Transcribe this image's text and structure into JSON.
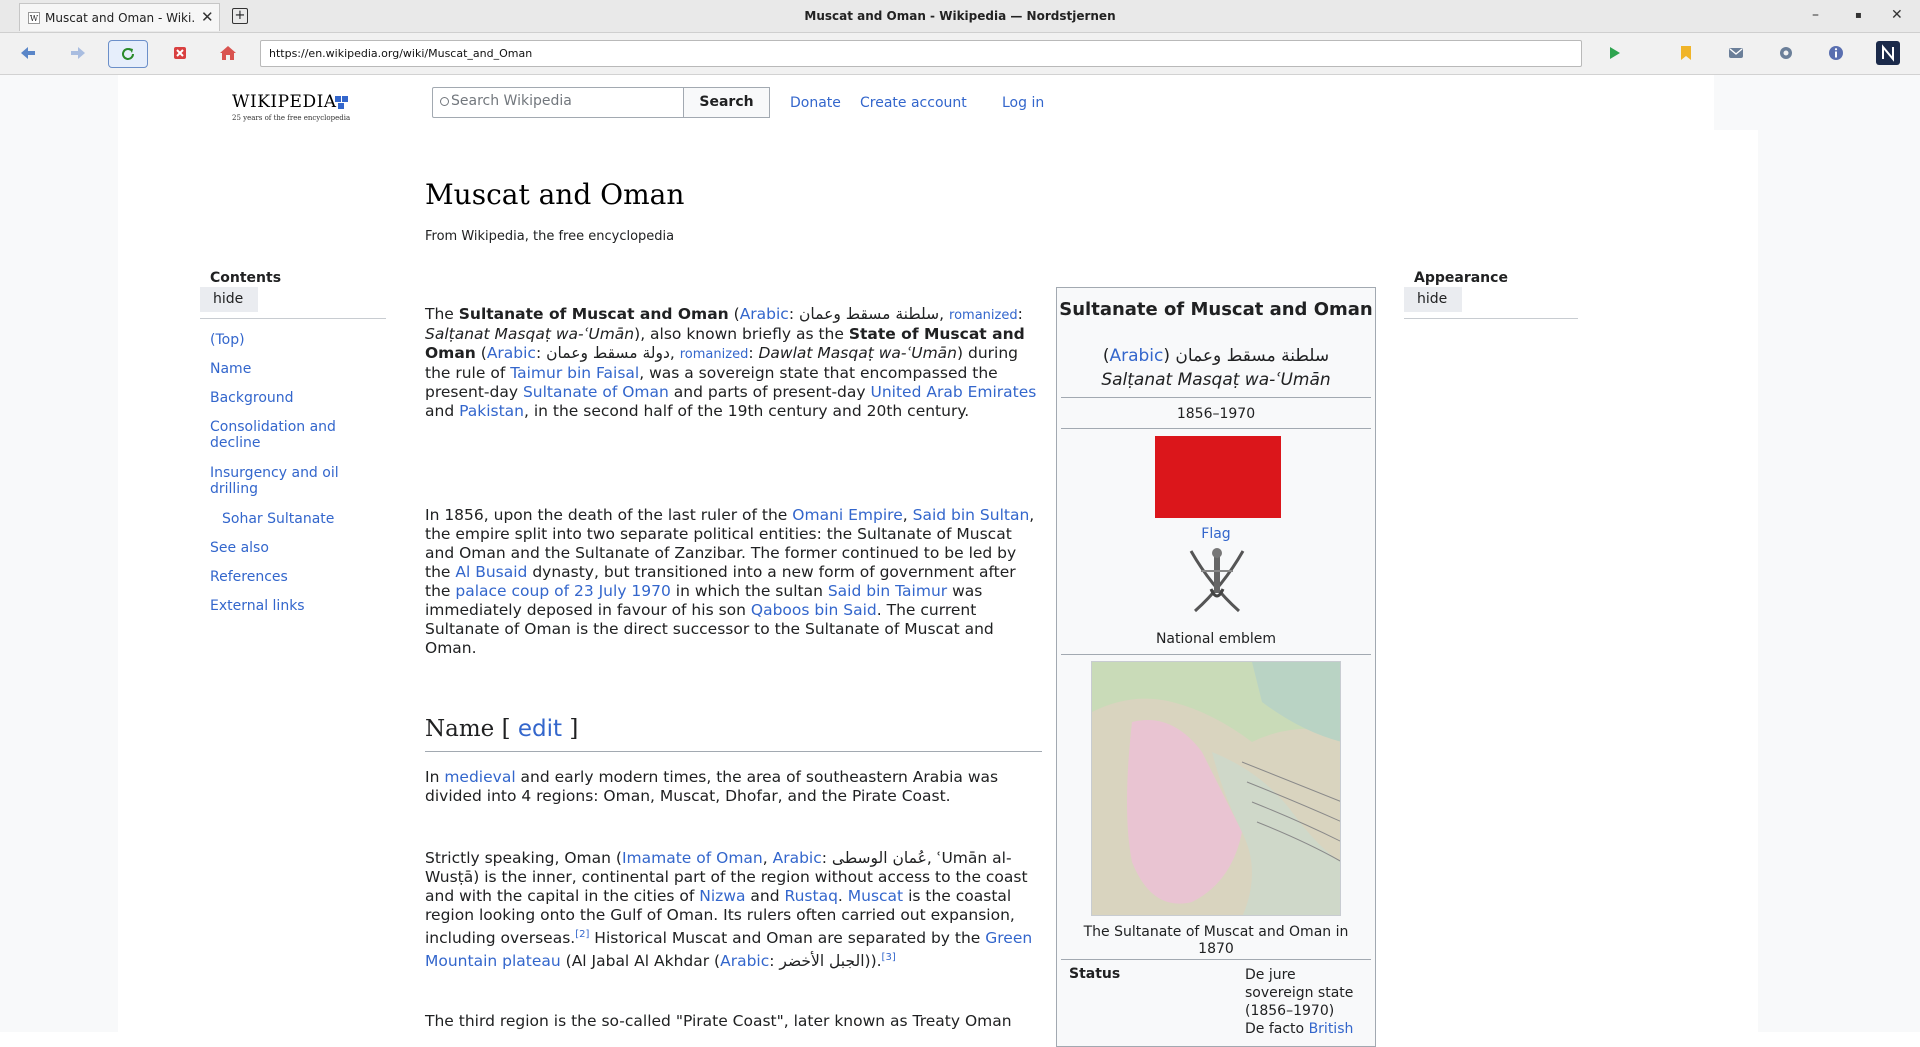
{
  "browser": {
    "tab_title": "Muscat and Oman - Wiki...",
    "tab_favicon": "W",
    "window_title": "Muscat and Oman - Wikipedia — Nordstjernen",
    "url": "https://en.wikipedia.org/wiki/Muscat_and_Oman",
    "icons": [
      "back-icon",
      "forward-icon",
      "reload-icon",
      "stop-icon",
      "home-icon",
      "play-icon",
      "bookmark-icon",
      "mail-icon",
      "gear-icon",
      "info-icon",
      "nordstjernen-icon"
    ],
    "win_min": "–",
    "win_max": "▪",
    "win_close": "✕",
    "tab_close": "✕",
    "newtab": "+"
  },
  "header": {
    "logo_word": "WIKIPEDIA",
    "logo_tag": "25 years of the free encyclopedia",
    "search_placeholder": "Search Wikipedia",
    "search_button": "Search",
    "donate": "Donate",
    "create_account": "Create account",
    "log_in": "Log in"
  },
  "article": {
    "title": "Muscat and Oman",
    "tagline": "From Wikipedia, the free encyclopedia",
    "section_name": "Name",
    "edit_label": "edit"
  },
  "toc": {
    "title": "Contents",
    "hide": "hide",
    "items": [
      "(Top)",
      "Name",
      "Background",
      "Consolidation and decline",
      "Insurgency and oil drilling",
      "Sohar Sultanate",
      "See also",
      "References",
      "External links"
    ]
  },
  "appearance": {
    "title": "Appearance",
    "hide": "hide"
  },
  "infobox": {
    "title": "Sultanate of Muscat and Oman",
    "arabic_label": "Arabic",
    "arabic_name": "سلطنة مسقط وعمان",
    "romanized": "Salṭanat Masqaṭ wa-ʿUmān",
    "years": "1856–1970",
    "flag_caption": "Flag",
    "emblem_caption": "National emblem",
    "map_caption": "The Sultanate of Muscat and Oman in 1870",
    "status_key": "Status",
    "status_value_1": "De jure sovereign state (1856–1970)",
    "status_value_2": "De facto",
    "status_value_link": "British",
    "flag_color": "#db161b",
    "link_color": "#3366cc"
  }
}
